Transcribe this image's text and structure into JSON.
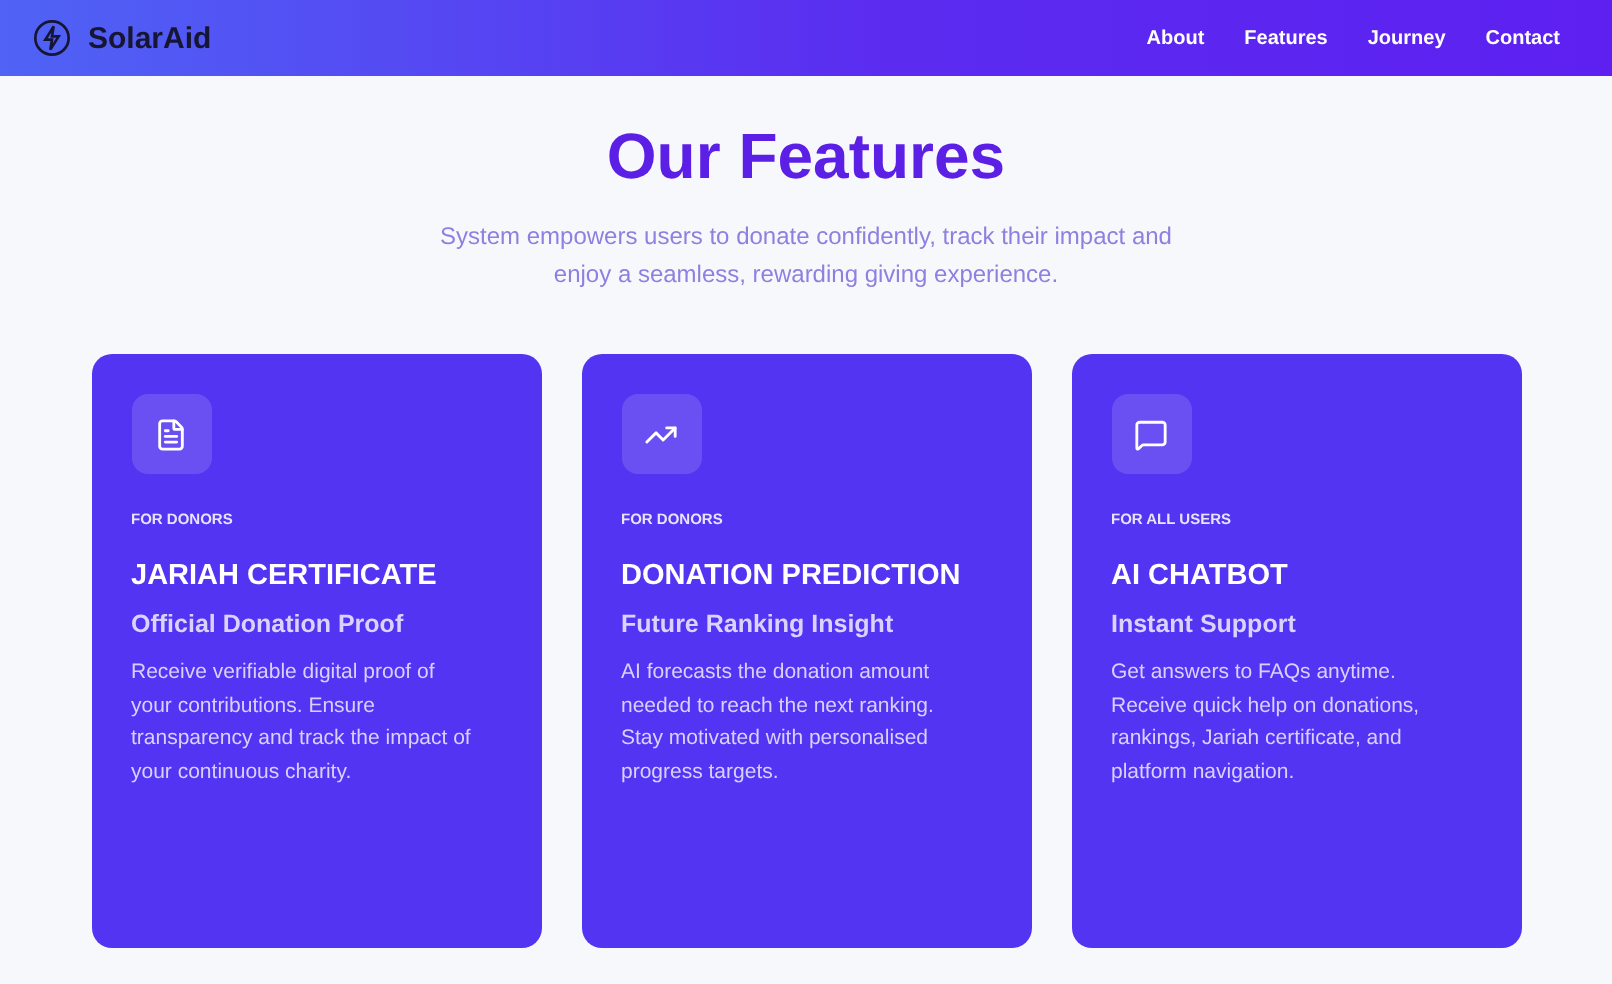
{
  "header": {
    "brand": "SolarAid",
    "nav": [
      {
        "label": "About"
      },
      {
        "label": "Features"
      },
      {
        "label": "Journey"
      },
      {
        "label": "Contact"
      }
    ]
  },
  "section": {
    "title": "Our Features",
    "subtitle": "System empowers users to donate confidently, track their impact and enjoy a seamless, rewarding giving experience."
  },
  "cards": [
    {
      "audience": "FOR DONORS",
      "title": "JARIAH CERTIFICATE",
      "subtitle": "Official Donation Proof",
      "body": "Receive verifiable digital proof of your contributions. Ensure transparency and track the impact of your continuous charity."
    },
    {
      "audience": "FOR DONORS",
      "title": "DONATION PREDICTION",
      "subtitle": "Future Ranking Insight",
      "body": "AI forecasts the donation amount needed to reach the next ranking. Stay motivated with personalised progress targets."
    },
    {
      "audience": "FOR ALL USERS",
      "title": "AI CHATBOT",
      "subtitle": "Instant Support",
      "body": "Get answers to FAQs anytime. Receive quick help on donations, rankings, Jariah certificate, and platform navigation."
    }
  ]
}
